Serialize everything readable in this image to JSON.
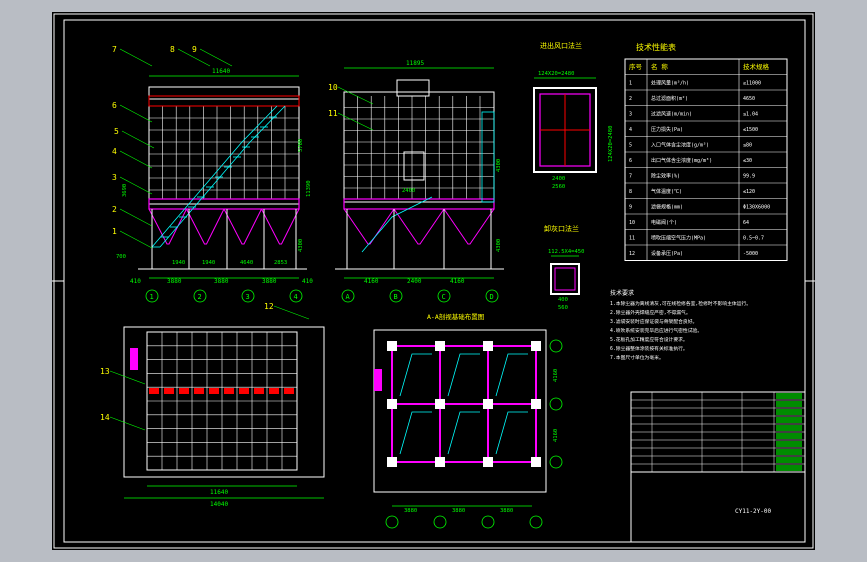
{
  "colors": {
    "background": "#000000",
    "frame": "#ffffff",
    "structure": "#ffffff",
    "dimension": "#00ff00",
    "annotation": "#ffff00",
    "platform": "#ff00ff",
    "stair": "#00ffff",
    "hatch": "#ff0000",
    "viewport": "#b9bdc4"
  },
  "front_view": {
    "callouts": [
      "7",
      "8",
      "9",
      "6",
      "5",
      "4",
      "3",
      "2",
      "1"
    ],
    "top_dim": "11640",
    "bottom_dims": [
      "1940",
      "1940",
      "4640",
      "2853"
    ],
    "overall_dims": [
      "410",
      "3880",
      "3880",
      "3880",
      "410"
    ],
    "height_dims": [
      "11390",
      "5700",
      "4300",
      "3690",
      "700"
    ],
    "axis_numbers": [
      "1",
      "2",
      "3",
      "4"
    ]
  },
  "side_view": {
    "callouts": [
      "10",
      "11"
    ],
    "top_dim": "11895",
    "height_dims": [
      "2400",
      "4300",
      "4300"
    ],
    "overall_dims": [
      "4160",
      "2400",
      "4160"
    ],
    "axis_numbers": [
      "A",
      "B",
      "C",
      "D"
    ]
  },
  "inlet_detail": {
    "title": "进出风口法兰",
    "top_dim": "124X20=2480",
    "side_dim": "124X20=2480",
    "inner_dims": [
      "2400",
      "2560"
    ]
  },
  "outlet_detail": {
    "title": "卸灰口法兰",
    "top_dim": "112.5X4=450",
    "inner_dims": [
      "400",
      "560"
    ]
  },
  "foundation": {
    "title": "A-A剖视基础布置图",
    "dims": [
      "3880",
      "3880",
      "3880"
    ],
    "side_dims": [
      "4160",
      "4160"
    ]
  },
  "plan_view": {
    "callouts": [
      "12",
      "13",
      "14"
    ],
    "dims": [
      "11640",
      "14040"
    ]
  },
  "tech_table": {
    "title": "技术性能表",
    "headers": [
      "序号",
      "名  称",
      "技术规格"
    ],
    "rows": [
      [
        "1",
        "处理风量(m³/h)",
        "≥11000"
      ],
      [
        "2",
        "总过滤面积(m²)",
        "4650"
      ],
      [
        "3",
        "过滤风速(m/min)",
        "≤1.04"
      ],
      [
        "4",
        "压力损失(Pa)",
        "≤1500"
      ],
      [
        "5",
        "入口气体含尘浓度(g/m³)",
        "≤80"
      ],
      [
        "6",
        "出口气体含尘浓度(mg/m³)",
        "≤30"
      ],
      [
        "7",
        "除尘效率(%)",
        "99.9"
      ],
      [
        "8",
        "气体温度(℃)",
        "≤120"
      ],
      [
        "9",
        "滤袋规格(mm)",
        "Φ130X6000"
      ],
      [
        "10",
        "电磁阀(个)",
        "64"
      ],
      [
        "11",
        "喷吹压缩空气压力(MPa)",
        "0.5~0.7"
      ],
      [
        "12",
        "设备承压(Pa)",
        "-5000"
      ]
    ]
  },
  "notes": {
    "title": "技术要求",
    "lines": [
      "1.本除尘器为离线清灰,可在线检修各室,检修时不影响主体运行。",
      "2.除尘器外壳焊缝应严密,不得漏气。",
      "3.滤袋安装时应保证袋与骨架配合良好。",
      "4.喷吹系统安装完毕后应进行气密性试验。",
      "5.花板孔加工精度应符合设计要求。",
      "6.除尘器整体涂装按有关标准执行。",
      "7.本图尺寸单位为毫米。"
    ]
  },
  "title_block": {
    "drawing_number": "CY11-2Y-00"
  }
}
